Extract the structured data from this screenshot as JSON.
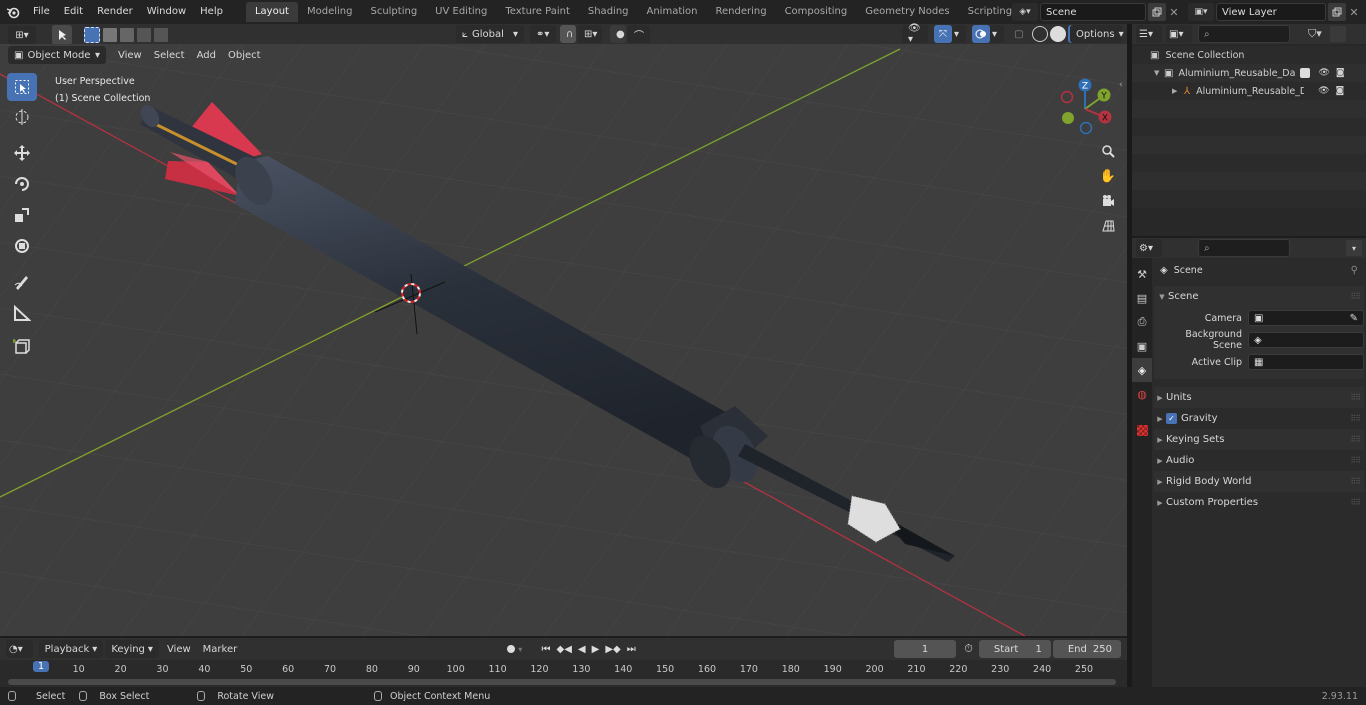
{
  "topbar": {
    "menus": [
      "File",
      "Edit",
      "Render",
      "Window",
      "Help"
    ],
    "workspaces": [
      "Layout",
      "Modeling",
      "Sculpting",
      "UV Editing",
      "Texture Paint",
      "Shading",
      "Animation",
      "Rendering",
      "Compositing",
      "Geometry Nodes",
      "Scripting"
    ],
    "active_workspace": "Layout",
    "scene_name": "Scene",
    "view_layer_name": "View Layer"
  },
  "viewport_header": {
    "mode": "Object Mode",
    "menus": [
      "View",
      "Select",
      "Add",
      "Object"
    ],
    "transform_orientation": "Global",
    "options_label": "Options"
  },
  "viewport": {
    "perspective_label": "User Perspective",
    "collection_label": "(1) Scene Collection",
    "gizmo_axes": [
      "Z",
      "Y",
      "X"
    ],
    "colors": {
      "x_axis": "#b33340",
      "y_axis": "#7fa32c",
      "z_axis": "#2f6fb7",
      "active_tool": "#4772b3"
    }
  },
  "tools": [
    "select-box-icon",
    "cursor-icon",
    "move-icon",
    "rotate-icon",
    "scale-icon",
    "transform-icon",
    "annotate-icon",
    "measure-icon",
    "add-cube-icon"
  ],
  "outliner": {
    "search_placeholder": "",
    "root": "Scene Collection",
    "items": [
      {
        "label": "Aluminium_Reusable_Dart_Sy"
      },
      {
        "label": "Aluminium_Reusable_Da"
      }
    ]
  },
  "properties": {
    "context_label": "Scene",
    "section_title": "Scene",
    "fields": [
      {
        "label": "Camera",
        "value": ""
      },
      {
        "label": "Background Scene",
        "value": ""
      },
      {
        "label": "Active Clip",
        "value": ""
      }
    ],
    "panels": [
      "Units",
      "Gravity",
      "Keying Sets",
      "Audio",
      "Rigid Body World",
      "Custom Properties"
    ],
    "gravity_enabled": true
  },
  "timeline": {
    "menus": [
      "Playback",
      "Keying",
      "View",
      "Marker"
    ],
    "current_frame": "1",
    "start_label": "Start",
    "start_value": "1",
    "end_label": "End",
    "end_value": "250",
    "ticks": [
      "1",
      "10",
      "20",
      "30",
      "40",
      "50",
      "60",
      "70",
      "80",
      "90",
      "100",
      "110",
      "120",
      "130",
      "140",
      "150",
      "160",
      "170",
      "180",
      "190",
      "200",
      "210",
      "220",
      "230",
      "240",
      "250"
    ]
  },
  "statusbar": {
    "hints": [
      "Select",
      "Box Select",
      "Rotate View",
      "Object Context Menu"
    ],
    "version": "2.93.11"
  }
}
